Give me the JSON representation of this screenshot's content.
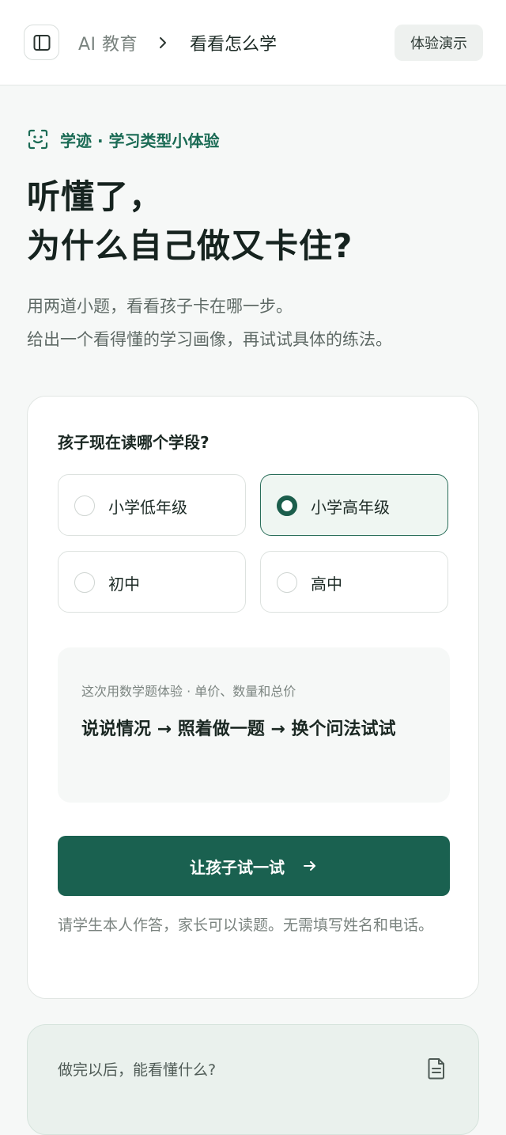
{
  "header": {
    "breadcrumb_root": "AI 教育",
    "breadcrumb_current": "看看怎么学",
    "demo_label": "体验演示"
  },
  "hero": {
    "eyebrow": "学迹 · 学习类型小体验",
    "title_line1": "听懂了，",
    "title_line2": "为什么自己做又卡住?",
    "desc_line1": "用两道小题，看看孩子卡在哪一步。",
    "desc_line2": "给出一个看得懂的学习画像，再试试具体的练法。"
  },
  "card": {
    "question": "孩子现在读哪个学段?",
    "options": [
      {
        "label": "小学低年级",
        "selected": false
      },
      {
        "label": "小学高年级",
        "selected": true
      },
      {
        "label": "初中",
        "selected": false
      },
      {
        "label": "高中",
        "selected": false
      }
    ],
    "info": {
      "subtitle": "这次用数学题体验 · 单价、数量和总价",
      "steps": "说说情况 → 照着做一题 → 换个问法试试"
    },
    "cta_label": "让孩子试一试",
    "note": "请学生本人作答，家长可以读题。无需填写姓名和电话。"
  },
  "bottom": {
    "text": "做完以后，能看懂什么?"
  },
  "colors": {
    "accent": "#1a6150",
    "eyebrow": "#1b6b55",
    "selected_bg": "#eff6f2"
  },
  "icons": {
    "sidebar": "sidebar-panel-icon",
    "chevron": "chevron-right-icon",
    "eyebrow": "face-scan-icon",
    "cta": "arrow-right-icon",
    "doc": "document-icon"
  }
}
